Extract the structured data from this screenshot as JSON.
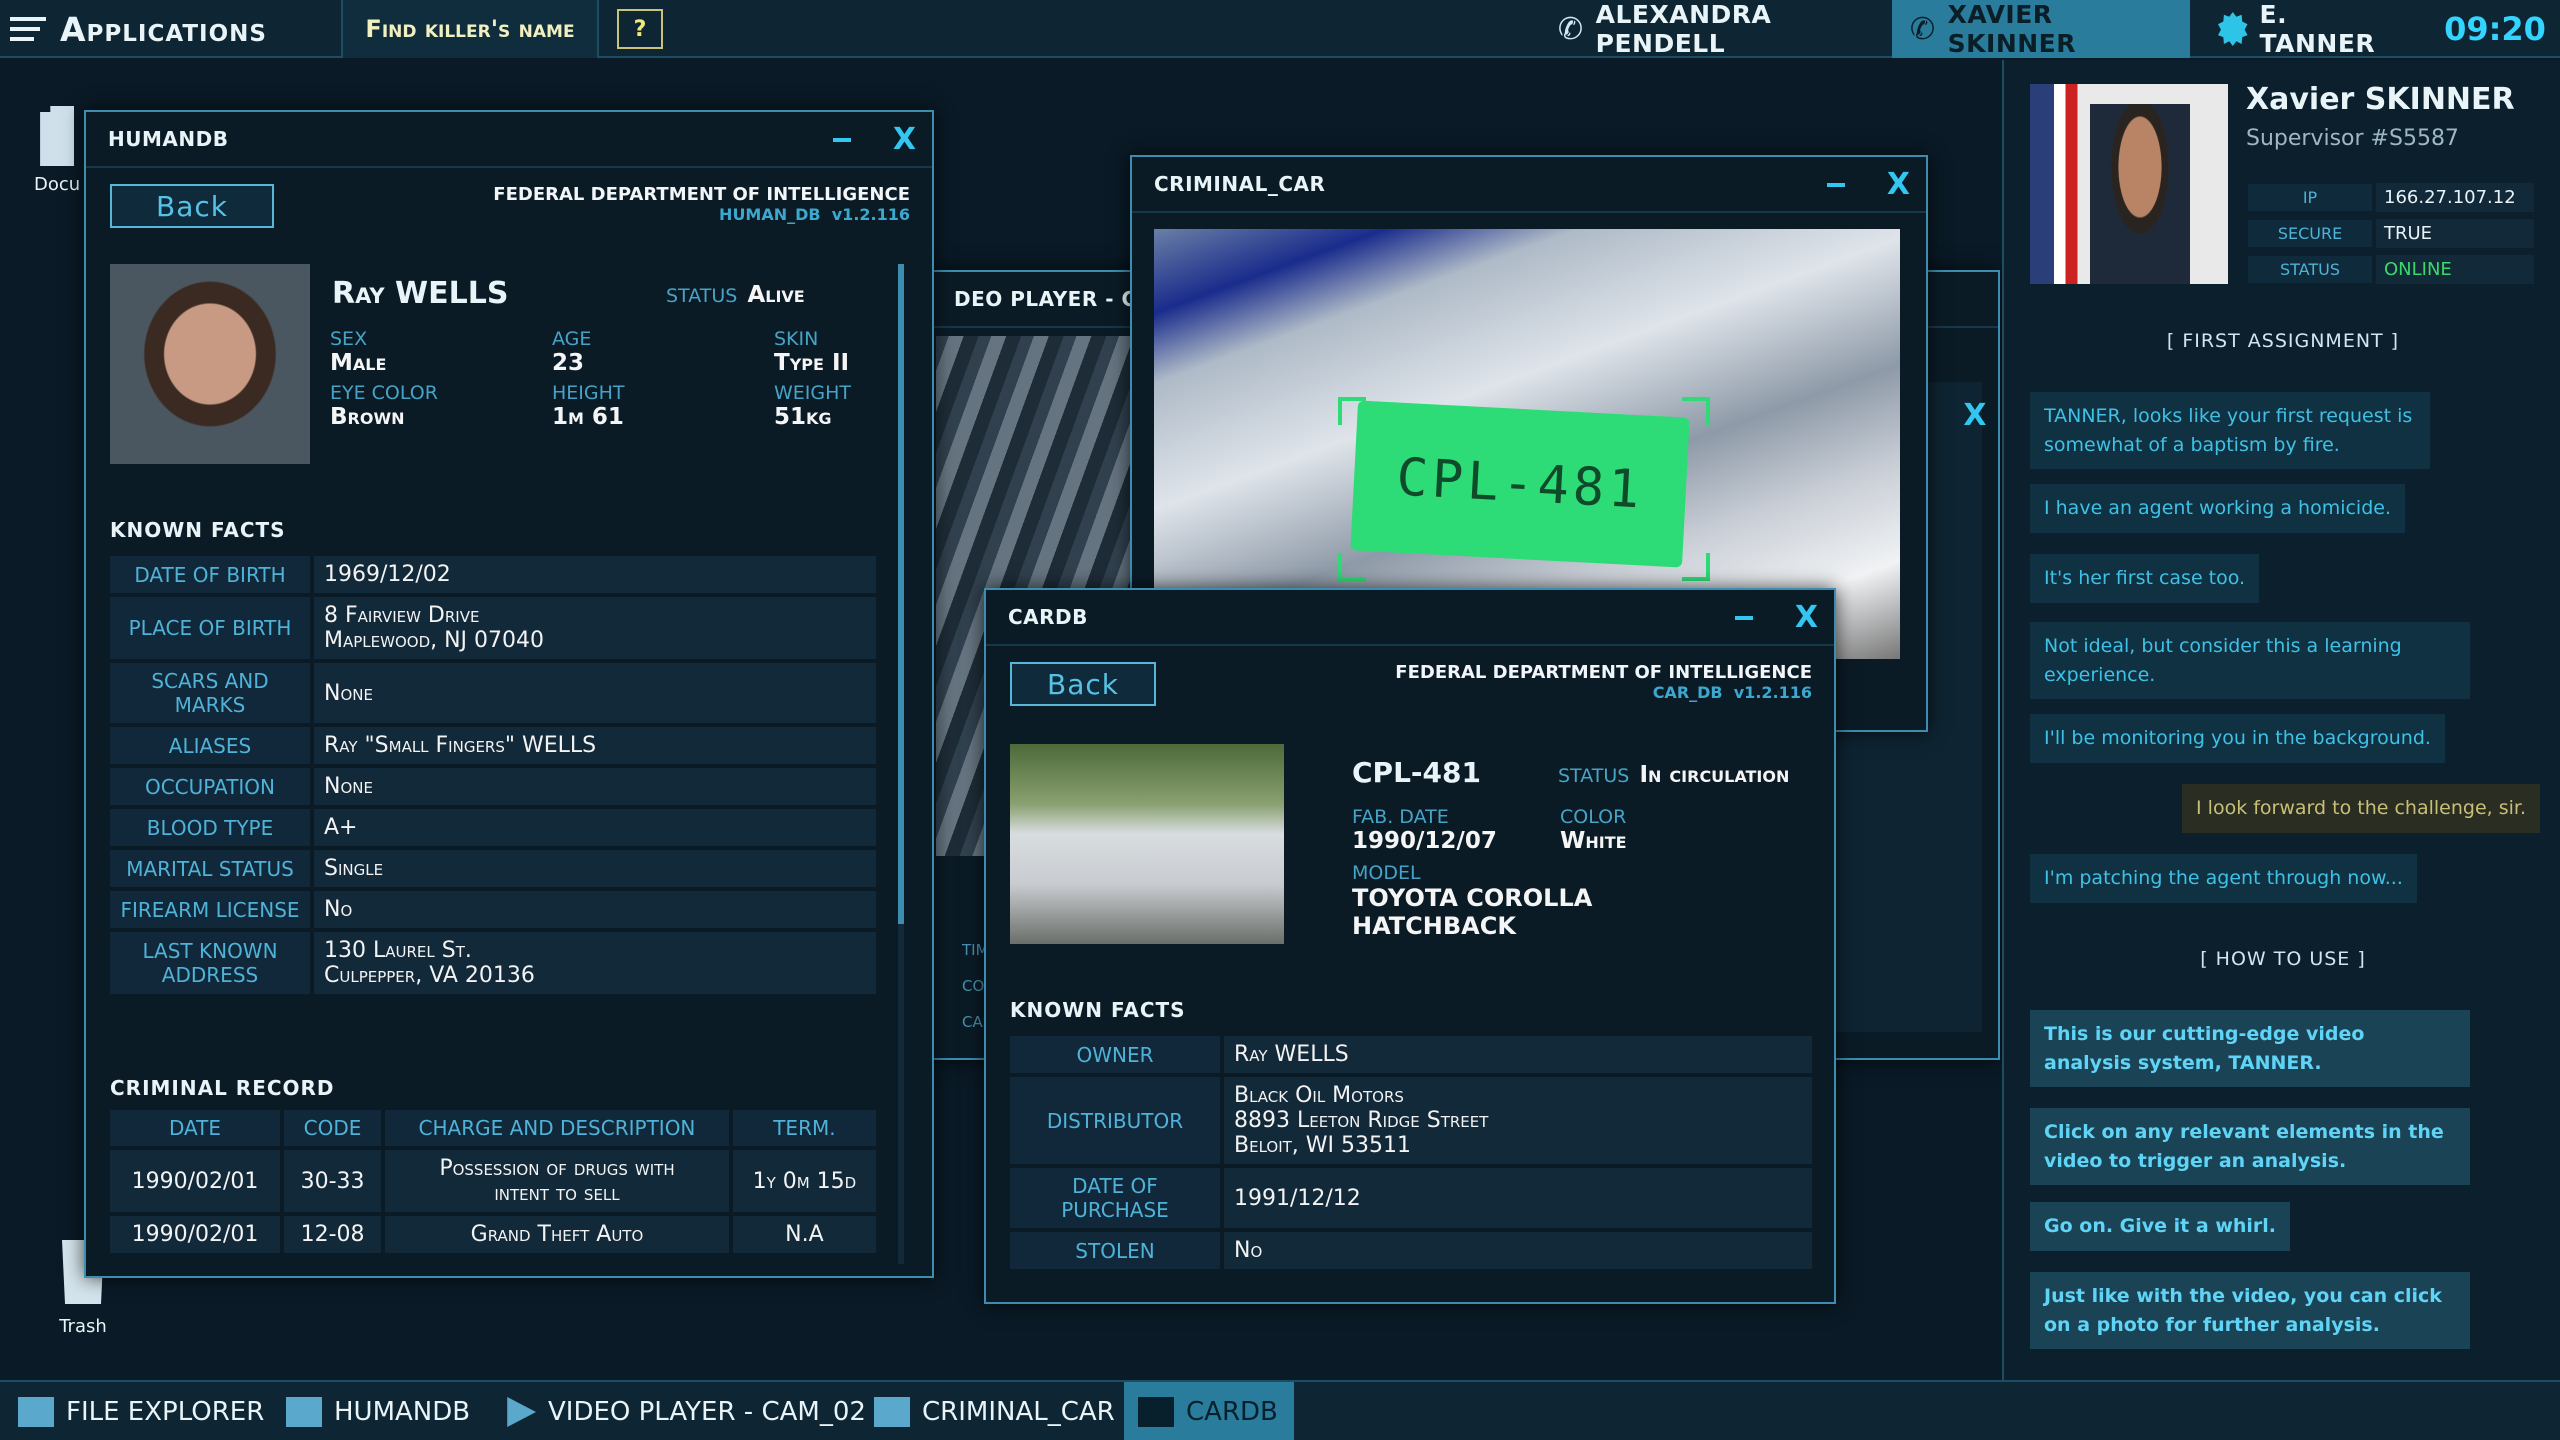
{
  "topbar": {
    "apps_label": "Applications",
    "task_label": "Find killer's name",
    "help_label": "?",
    "contacts": [
      "ALEXANDRA PENDELL",
      "XAVIER SKINNER",
      "E. TANNER"
    ],
    "clock": "09:20"
  },
  "desktop": {
    "doc_label": "Docu",
    "trash_label": "Trash"
  },
  "humandb": {
    "title": "HUMANDB",
    "back_label": "Back",
    "dept": "FEDERAL DEPARTMENT OF INTELLIGENCE",
    "db": "HUMAN_DB",
    "version": "v1.2.116",
    "first_name": "Ray",
    "last_name": "WELLS",
    "status_label": "STATUS",
    "status_value": "Alive",
    "sex_label": "SEX",
    "sex_value": "Male",
    "age_label": "AGE",
    "age_value": "23",
    "skin_label": "SKIN",
    "skin_value": "Type II",
    "eye_label": "EYE COLOR",
    "eye_value": "Brown",
    "height_label": "HEIGHT",
    "height_value": "1m 61",
    "weight_label": "WEIGHT",
    "weight_value": "51kg",
    "facts_heading": "KNOWN FACTS",
    "facts": [
      {
        "k": "DATE OF BIRTH",
        "v": "1969/12/02"
      },
      {
        "k": "PLACE OF BIRTH",
        "v": "8 Fairview Drive",
        "v2": "Maplewood, NJ 07040"
      },
      {
        "k": "SCARS AND MARKS",
        "v": "None"
      },
      {
        "k": "ALIASES",
        "v": "Ray \"Small Fingers\" WELLS"
      },
      {
        "k": "OCCUPATION",
        "v": "None"
      },
      {
        "k": "BLOOD TYPE",
        "v": "A+"
      },
      {
        "k": "MARITAL STATUS",
        "v": "Single"
      },
      {
        "k": "FIREARM LICENSE",
        "v": "No"
      },
      {
        "k": "LAST KNOWN ADDRESS",
        "v": "130 Laurel St.",
        "v2": "Culpepper, VA 20136"
      }
    ],
    "record_heading": "CRIMINAL RECORD",
    "record_headers": [
      "DATE",
      "CODE",
      "CHARGE AND DESCRIPTION",
      "TERM."
    ],
    "records": [
      {
        "date": "1990/02/01",
        "code": "30-33",
        "charge": "Possession of drugs with",
        "charge2": "intent to sell",
        "term": "1y 0m 15d"
      },
      {
        "date": "1990/02/01",
        "code": "12-08",
        "charge": "Grand Theft Auto",
        "charge2": "",
        "term": "N.A"
      }
    ]
  },
  "videoplayer": {
    "title": "DEO PLAYER - CAM_(",
    "side_labels": [
      "TIM",
      "COD",
      "CAS"
    ]
  },
  "criminal_car": {
    "title": "CRIMINAL_CAR",
    "plate_text": "CPL-481"
  },
  "cardb": {
    "title": "CARDB",
    "back_label": "Back",
    "dept": "FEDERAL DEPARTMENT OF INTELLIGENCE",
    "db": "CAR_DB",
    "version": "v1.2.116",
    "plate": "CPL-481",
    "status_label": "STATUS",
    "status_value": "In circulation",
    "fab_label": "FAB. DATE",
    "fab_value": "1990/12/07",
    "color_label": "COLOR",
    "color_value": "White",
    "model_label": "MODEL",
    "model_value": "TOYOTA COROLLA HATCHBACK",
    "facts_heading": "KNOWN FACTS",
    "facts": [
      {
        "k": "OWNER",
        "v": "Ray WELLS"
      },
      {
        "k": "DISTRIBUTOR",
        "v": "Black Oil Motors",
        "v2": "8893 Leeton Ridge Street",
        "v3": "Beloit, WI 53511"
      },
      {
        "k": "DATE OF PURCHASE",
        "v": "1991/12/12"
      },
      {
        "k": "STOLEN",
        "v": "No"
      }
    ]
  },
  "profile": {
    "name": "Xavier SKINNER",
    "role": "Supervisor #S5587",
    "ip_label": "IP",
    "ip_value": "166.27.107.12",
    "secure_label": "SECURE",
    "secure_value": "TRUE",
    "status_label": "STATUS",
    "status_value": "ONLINE",
    "first_assignment": "[   FIRST ASSIGNMENT   ]",
    "how_to_use": "[   HOW TO USE   ]",
    "messages": [
      "TANNER, looks like your first request is somewhat of a baptism by fire.",
      "I have an agent working a homicide.",
      "It's her first case too.",
      "Not ideal, but consider this a learning experience.",
      "I'll be monitoring you in the background.",
      "I look forward to the challenge, sir.",
      "I'm patching the agent through now..."
    ],
    "how_messages": [
      "This is our cutting-edge video analysis system, TANNER.",
      "Click on any relevant elements in the video to trigger an analysis.",
      "Go on. Give it a whirl.",
      "Just like with the video, you can click on a photo for further analysis."
    ]
  },
  "taskbar": {
    "items": [
      "FILE EXPLORER",
      "HUMANDB",
      "VIDEO PLAYER - CAM_02",
      "CRIMINAL_CAR",
      "CARDB"
    ]
  },
  "colors": {
    "accent": "#33c6f0",
    "plate_highlight": "#2ddc76",
    "active_tab": "#2a7c9c"
  }
}
